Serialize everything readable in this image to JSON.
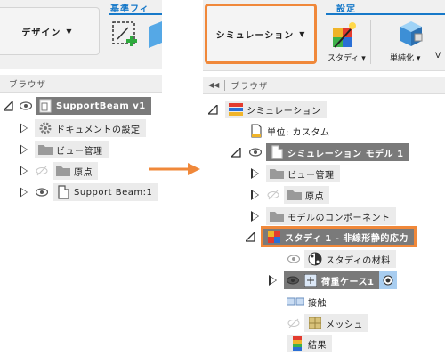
{
  "left": {
    "workspace_button": "デザイン",
    "tab_label": "基準フィ",
    "browser_title": "ブラウザ",
    "tree": [
      {
        "label": "SupportBeam v1"
      },
      {
        "label": "ドキュメントの設定"
      },
      {
        "label": "ビュー管理"
      },
      {
        "label": "原点"
      },
      {
        "label": "Support Beam:1"
      }
    ]
  },
  "right": {
    "workspace_button": "シミュレーション",
    "tab_label": "設定",
    "tools": [
      {
        "label": "スタディ",
        "icon": "study-wizard-icon"
      },
      {
        "label": "単純化",
        "icon": "simplify-icon"
      },
      {
        "label": "V"
      }
    ],
    "browser_title": "ブラウザ",
    "tree": [
      {
        "label": "シミュレーション"
      },
      {
        "label": "単位: カスタム"
      },
      {
        "label": "シミュレーション モデル 1"
      },
      {
        "label": "ビュー管理"
      },
      {
        "label": "原点"
      },
      {
        "label": "モデルのコンポーネント"
      },
      {
        "label": "スタディ 1 - 非線形静的応力"
      },
      {
        "label": "スタディの材料"
      },
      {
        "label": "荷重ケース1"
      },
      {
        "label": "接触"
      },
      {
        "label": "メッシュ"
      },
      {
        "label": "結果"
      }
    ]
  },
  "colors": {
    "accent_orange": "#f0883a",
    "tab_blue": "#1779c9",
    "selected_row": "#7a7a7a"
  }
}
